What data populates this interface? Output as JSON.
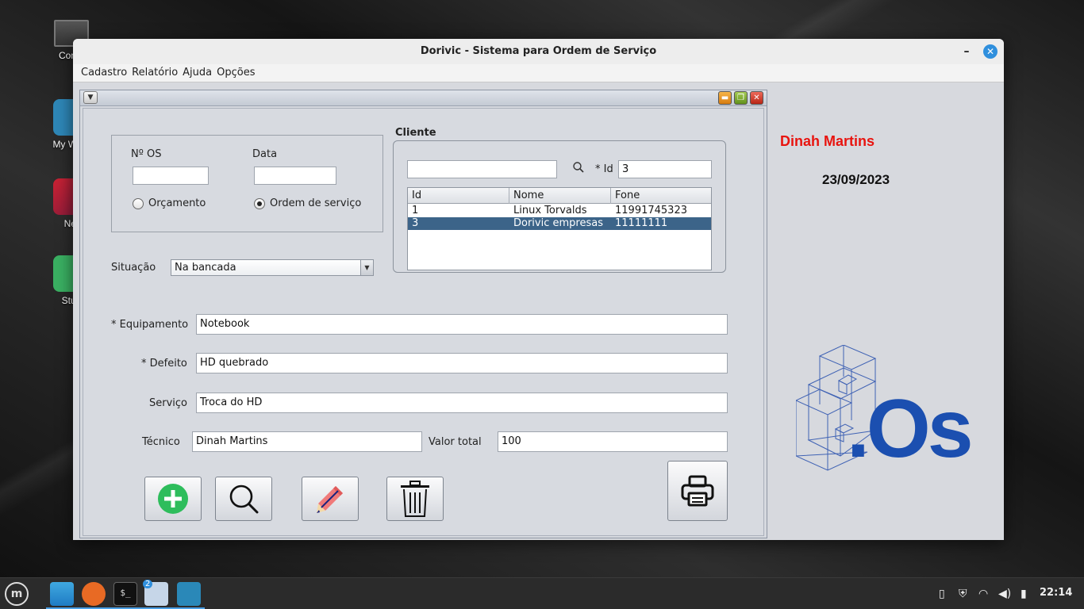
{
  "desktop": {
    "icons": [
      {
        "label": "Comp",
        "glyph": "computer-icon"
      },
      {
        "label": "My Work",
        "glyph": "mysql-workbench-icon"
      },
      {
        "label": "Net",
        "glyph": "netbeans-icon"
      },
      {
        "label": "Stud",
        "glyph": "android-studio-icon"
      }
    ]
  },
  "window": {
    "title": "Dorivic - Sistema para Ordem de Serviço",
    "min_glyph": "–",
    "close_glyph": "✕"
  },
  "menu": {
    "items": [
      "Cadastro",
      "Relatório",
      "Ajuda",
      "Opções"
    ]
  },
  "inner_frame": {
    "menu_glyph": "▼"
  },
  "os_form": {
    "os_number_label": "Nº OS",
    "os_number_value": "",
    "date_label": "Data",
    "date_value": "",
    "radio_budget_label": "Orçamento",
    "radio_budget_selected": false,
    "radio_order_label": "Ordem de serviço",
    "radio_order_selected": true,
    "status_label": "Situação",
    "status_value": "Na bancada",
    "equipment_label": "* Equipamento",
    "equipment_value": "Notebook",
    "defect_label": "* Defeito",
    "defect_value": "HD quebrado",
    "service_label": "Serviço",
    "service_value": "Troca do HD",
    "technician_label": "Técnico",
    "technician_value": "Dinah Martins",
    "total_label": "Valor total",
    "total_value": "100"
  },
  "client": {
    "title": "Cliente",
    "search_value": "",
    "id_label": "* Id",
    "id_value": "3",
    "columns": [
      "Id",
      "Nome",
      "Fone"
    ],
    "rows": [
      {
        "id": "1",
        "name": "Linux Torvalds",
        "phone": "11991745323",
        "selected": false
      },
      {
        "id": "3",
        "name": "Dorivic empresas",
        "phone": "11111111",
        "selected": true
      }
    ]
  },
  "side": {
    "user_name": "Dinah Martins",
    "date": "23/09/2023",
    "logo_text": ".Os"
  },
  "colors": {
    "user_name": "#e8140f",
    "logo_blue": "#1b4fb0",
    "selection": "#3c6489",
    "add_green": "#2ebd5c"
  },
  "taskbar": {
    "clock": "22:14",
    "workspace_badge": "2"
  }
}
